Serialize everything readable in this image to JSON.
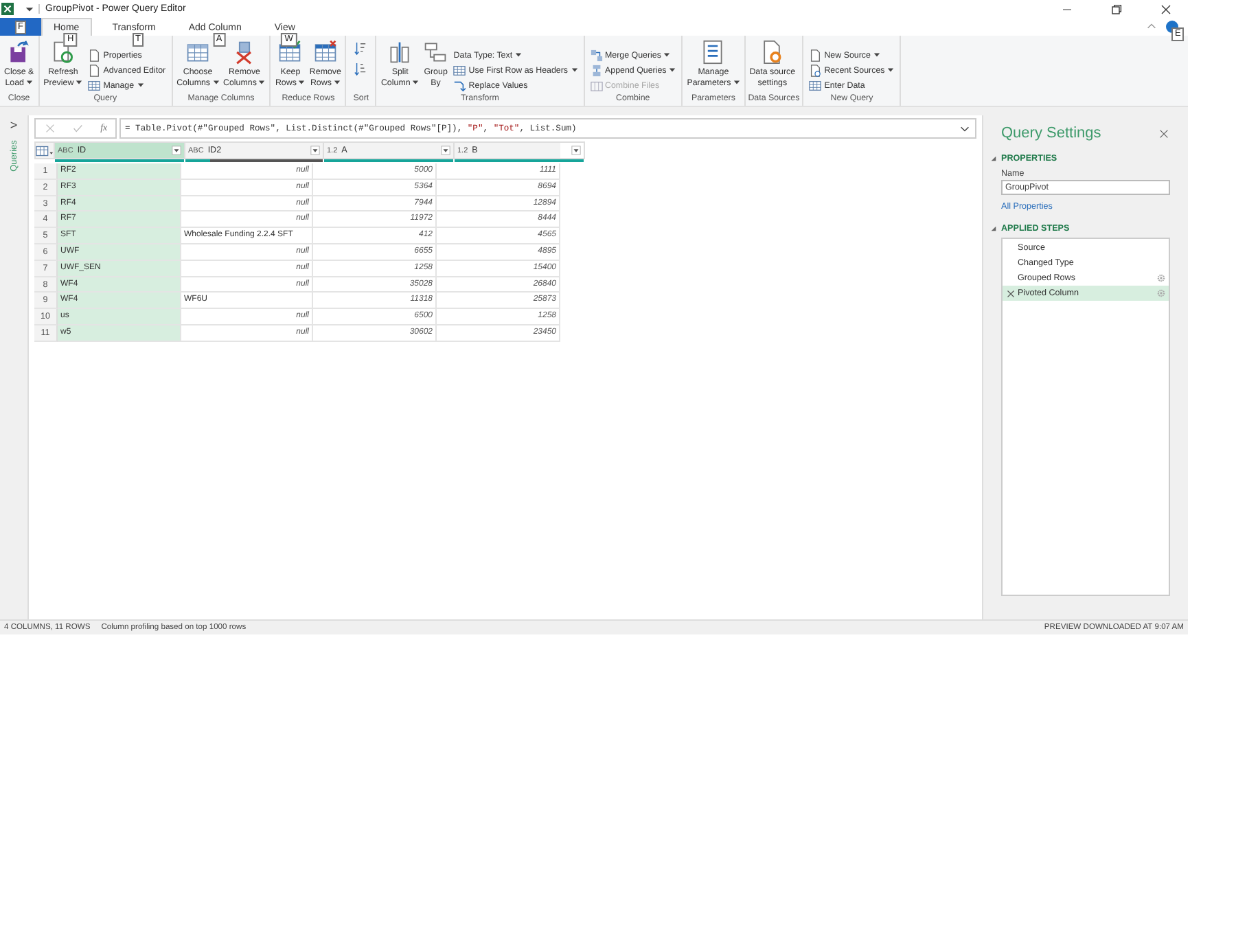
{
  "title_bar": {
    "title": "GroupPivot - Power Query Editor"
  },
  "tabs": [
    {
      "kind": "file",
      "keytip": "F",
      "selected": false
    },
    {
      "kind": "tab",
      "label": "Home",
      "keytip": "H",
      "selected": true
    },
    {
      "kind": "tab",
      "label": "Transform",
      "keytip": "T",
      "selected": false
    },
    {
      "kind": "tab",
      "label": "Add Column",
      "keytip": "A",
      "selected": false
    },
    {
      "kind": "tab",
      "label": "View",
      "keytip": "W",
      "selected": false
    }
  ],
  "help_keytip": "E",
  "ribbon_groups": [
    {
      "label": "Close",
      "items": [
        {
          "kind": "large",
          "lines": [
            "Close &",
            "Load"
          ],
          "dropdown": true
        }
      ]
    },
    {
      "label": "Query",
      "items": [
        {
          "kind": "large",
          "lines": [
            "Refresh",
            "Preview"
          ],
          "dropdown": true
        },
        {
          "kind": "stack",
          "items": [
            {
              "label": "Properties",
              "dropdown": false,
              "disabled": false
            },
            {
              "label": "Advanced Editor",
              "dropdown": false,
              "disabled": false
            },
            {
              "label": "Manage",
              "dropdown": true,
              "disabled": false
            }
          ]
        }
      ]
    },
    {
      "label": "Manage Columns",
      "items": [
        {
          "kind": "large",
          "lines": [
            "Choose",
            "Columns"
          ],
          "dropdown": true
        },
        {
          "kind": "large",
          "lines": [
            "Remove",
            "Columns"
          ],
          "dropdown": true
        }
      ]
    },
    {
      "label": "Reduce Rows",
      "items": [
        {
          "kind": "large",
          "lines": [
            "Keep",
            "Rows"
          ],
          "dropdown": true
        },
        {
          "kind": "large",
          "lines": [
            "Remove",
            "Rows"
          ],
          "dropdown": true
        }
      ]
    },
    {
      "label": "Sort",
      "items": [
        {
          "kind": "sort"
        }
      ]
    },
    {
      "label": "Transform",
      "items": [
        {
          "kind": "large",
          "lines": [
            "Split",
            "Column"
          ],
          "dropdown": true
        },
        {
          "kind": "large",
          "lines": [
            "Group",
            "By"
          ],
          "dropdown": false
        },
        {
          "kind": "stack",
          "items": [
            {
              "label": "Data Type: Text",
              "dropdown": true,
              "disabled": false
            },
            {
              "label": "Use First Row as Headers",
              "dropdown": true,
              "disabled": false
            },
            {
              "label": "Replace Values",
              "dropdown": false,
              "disabled": false
            }
          ]
        }
      ]
    },
    {
      "label": "Combine",
      "items": [
        {
          "kind": "stack",
          "items": [
            {
              "label": "Merge Queries",
              "dropdown": true,
              "disabled": false
            },
            {
              "label": "Append Queries",
              "dropdown": true,
              "disabled": false
            },
            {
              "label": "Combine Files",
              "dropdown": false,
              "disabled": true
            }
          ]
        }
      ]
    },
    {
      "label": "Parameters",
      "items": [
        {
          "kind": "large",
          "lines": [
            "Manage",
            "Parameters"
          ],
          "dropdown": true
        }
      ]
    },
    {
      "label": "Data Sources",
      "items": [
        {
          "kind": "large",
          "lines": [
            "Data source",
            "settings"
          ],
          "dropdown": false
        }
      ]
    },
    {
      "label": "New Query",
      "items": [
        {
          "kind": "stack",
          "items": [
            {
              "label": "New Source",
              "dropdown": true,
              "disabled": false
            },
            {
              "label": "Recent Sources",
              "dropdown": true,
              "disabled": false
            },
            {
              "label": "Enter Data",
              "dropdown": false,
              "disabled": false
            }
          ]
        }
      ]
    }
  ],
  "queries_pane": {
    "expand": ">",
    "label": "Queries"
  },
  "formula_bar": {
    "fx": "fx",
    "tokens": [
      {
        "kind": "code",
        "text": "= Table.Pivot(#\"Grouped Rows\", List.Distinct(#\"Grouped Rows\"[P]), "
      },
      {
        "kind": "string",
        "text": "\"P\""
      },
      {
        "kind": "code",
        "text": ", "
      },
      {
        "kind": "string",
        "text": "\"Tot\""
      },
      {
        "kind": "code",
        "text": ", List.Sum)"
      }
    ]
  },
  "table": {
    "columns": [
      {
        "type": "ABC",
        "name": "ID",
        "selected": true,
        "level": 1
      },
      {
        "type": "ABC",
        "name": "ID2",
        "selected": false,
        "level": 0.18
      },
      {
        "type": "1.2",
        "name": "A",
        "selected": false,
        "level": 1
      },
      {
        "type": "1.2",
        "name": "B",
        "selected": false,
        "level": 1
      }
    ],
    "rows": [
      {
        "num": "1",
        "cells": [
          {
            "kind": "text",
            "text": "RF2"
          },
          {
            "kind": "null",
            "text": "null"
          },
          {
            "kind": "number",
            "text": "5000"
          },
          {
            "kind": "number",
            "text": "1111"
          }
        ]
      },
      {
        "num": "2",
        "cells": [
          {
            "kind": "text",
            "text": "RF3"
          },
          {
            "kind": "null",
            "text": "null"
          },
          {
            "kind": "number",
            "text": "5364"
          },
          {
            "kind": "number",
            "text": "8694"
          }
        ]
      },
      {
        "num": "3",
        "cells": [
          {
            "kind": "text",
            "text": "RF4"
          },
          {
            "kind": "null",
            "text": "null"
          },
          {
            "kind": "number",
            "text": "7944"
          },
          {
            "kind": "number",
            "text": "12894"
          }
        ]
      },
      {
        "num": "4",
        "cells": [
          {
            "kind": "text",
            "text": "RF7"
          },
          {
            "kind": "null",
            "text": "null"
          },
          {
            "kind": "number",
            "text": "11972"
          },
          {
            "kind": "number",
            "text": "8444"
          }
        ]
      },
      {
        "num": "5",
        "cells": [
          {
            "kind": "text",
            "text": "SFT"
          },
          {
            "kind": "text",
            "text": "Wholesale Funding 2.2.4 SFT"
          },
          {
            "kind": "number",
            "text": "412"
          },
          {
            "kind": "number",
            "text": "4565"
          }
        ]
      },
      {
        "num": "6",
        "cells": [
          {
            "kind": "text",
            "text": "UWF"
          },
          {
            "kind": "null",
            "text": "null"
          },
          {
            "kind": "number",
            "text": "6655"
          },
          {
            "kind": "number",
            "text": "4895"
          }
        ]
      },
      {
        "num": "7",
        "cells": [
          {
            "kind": "text",
            "text": "UWF_SEN"
          },
          {
            "kind": "null",
            "text": "null"
          },
          {
            "kind": "number",
            "text": "1258"
          },
          {
            "kind": "number",
            "text": "15400"
          }
        ]
      },
      {
        "num": "8",
        "cells": [
          {
            "kind": "text",
            "text": "WF4"
          },
          {
            "kind": "null",
            "text": "null"
          },
          {
            "kind": "number",
            "text": "35028"
          },
          {
            "kind": "number",
            "text": "26840"
          }
        ]
      },
      {
        "num": "9",
        "cells": [
          {
            "kind": "text",
            "text": "WF4"
          },
          {
            "kind": "text",
            "text": "WF6U"
          },
          {
            "kind": "number",
            "text": "11318"
          },
          {
            "kind": "number",
            "text": "25873"
          }
        ]
      },
      {
        "num": "10",
        "cells": [
          {
            "kind": "text",
            "text": "us"
          },
          {
            "kind": "null",
            "text": "null"
          },
          {
            "kind": "number",
            "text": "6500"
          },
          {
            "kind": "number",
            "text": "1258"
          }
        ]
      },
      {
        "num": "11",
        "cells": [
          {
            "kind": "text",
            "text": "w5"
          },
          {
            "kind": "null",
            "text": "null"
          },
          {
            "kind": "number",
            "text": "30602"
          },
          {
            "kind": "number",
            "text": "23450"
          }
        ]
      }
    ]
  },
  "query_settings": {
    "title": "Query Settings",
    "properties_heading": "PROPERTIES",
    "name_label": "Name",
    "name_value": "GroupPivot",
    "all_properties": "All Properties",
    "steps_heading": "APPLIED STEPS",
    "steps": [
      {
        "label": "Source",
        "has_settings": false,
        "selected": false
      },
      {
        "label": "Changed Type",
        "has_settings": false,
        "selected": false
      },
      {
        "label": "Grouped Rows",
        "has_settings": true,
        "selected": false
      },
      {
        "label": "Pivoted Column",
        "has_settings": true,
        "selected": true
      }
    ]
  },
  "status_bar": {
    "counts": "4 COLUMNS, 11 ROWS",
    "profiling": "Column profiling based on top 1000 rows",
    "preview": "PREVIEW DOWNLOADED AT 9:07 AM"
  }
}
